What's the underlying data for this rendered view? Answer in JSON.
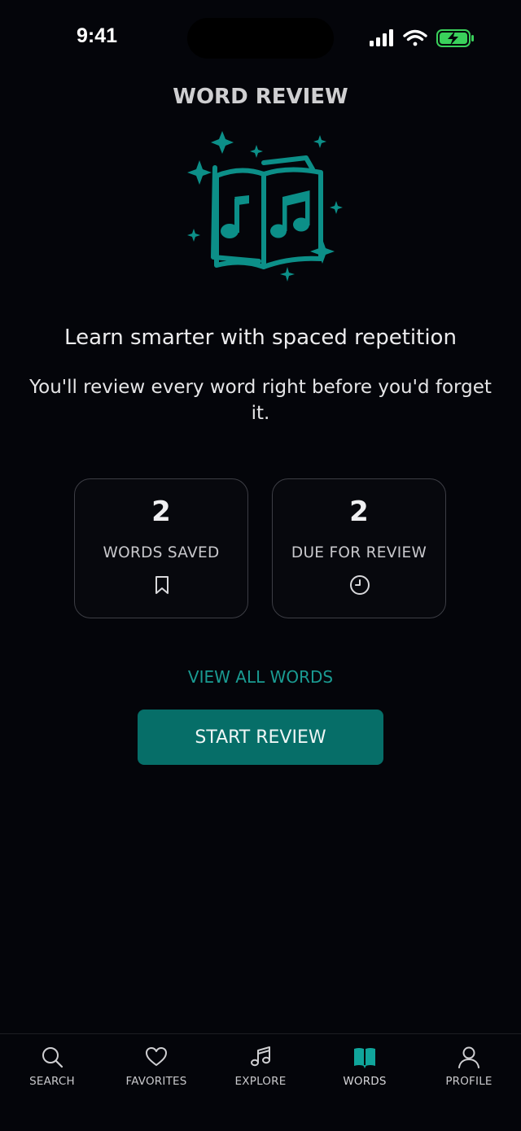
{
  "status_bar": {
    "time": "9:41"
  },
  "header": {
    "title": "WORD REVIEW"
  },
  "hero": {
    "icon": "sparkle-music-book-icon",
    "accent": "#0c8f88"
  },
  "intro": {
    "tagline": "Learn smarter with spaced repetition",
    "description": "You'll review every word right before you'd forget it."
  },
  "stats": [
    {
      "value": "2",
      "label": "WORDS SAVED",
      "icon": "bookmark-icon"
    },
    {
      "value": "2",
      "label": "DUE FOR REVIEW",
      "icon": "clock-icon"
    }
  ],
  "actions": {
    "view_all": "VIEW ALL WORDS",
    "start_review": "START REVIEW"
  },
  "tabs": [
    {
      "label": "SEARCH",
      "icon": "search-icon",
      "active": false
    },
    {
      "label": "FAVORITES",
      "icon": "heart-icon",
      "active": false
    },
    {
      "label": "EXPLORE",
      "icon": "music-note-icon",
      "active": false
    },
    {
      "label": "WORDS",
      "icon": "open-book-icon",
      "active": true
    },
    {
      "label": "PROFILE",
      "icon": "user-icon",
      "active": false
    }
  ],
  "colors": {
    "accent": "#0c8f88",
    "button": "#066e68",
    "background": "#04050a"
  }
}
